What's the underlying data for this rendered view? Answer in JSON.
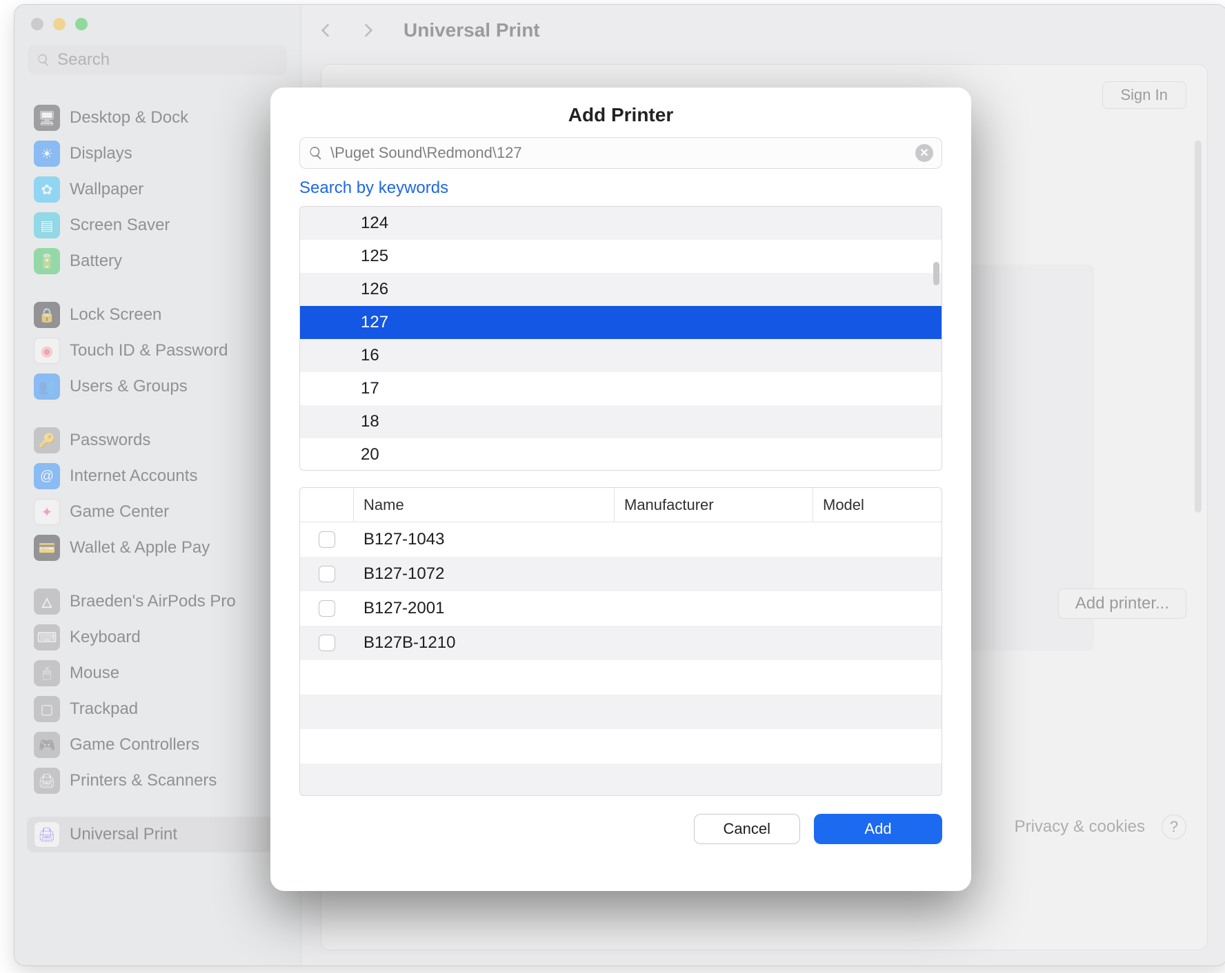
{
  "sidebar": {
    "search_placeholder": "Search",
    "items": [
      {
        "label": "Desktop & Dock",
        "icon_bg": "#4b4b4e",
        "glyph": "🖥"
      },
      {
        "label": "Displays",
        "icon_bg": "#1b88ff",
        "glyph": "☀"
      },
      {
        "label": "Wallpaper",
        "icon_bg": "#28c3ff",
        "glyph": "✿"
      },
      {
        "label": "Screen Saver",
        "icon_bg": "#2ec7e5",
        "glyph": "▤"
      },
      {
        "label": "Battery",
        "icon_bg": "#34c759",
        "glyph": "🔋"
      }
    ],
    "items2": [
      {
        "label": "Lock Screen",
        "icon_bg": "#2f2f32",
        "glyph": "🔒"
      },
      {
        "label": "Touch ID & Password",
        "icon_bg": "#ffffff",
        "glyph": "◉",
        "glyph_color": "#ff5a66",
        "border": true
      },
      {
        "label": "Users & Groups",
        "icon_bg": "#1b88ff",
        "glyph": "👥"
      }
    ],
    "items3": [
      {
        "label": "Passwords",
        "icon_bg": "#9d9da0",
        "glyph": "🔑"
      },
      {
        "label": "Internet Accounts",
        "icon_bg": "#1b88ff",
        "glyph": "@"
      },
      {
        "label": "Game Center",
        "icon_bg": "#ffffff",
        "glyph": "✦",
        "glyph_color": "#ff4da0",
        "border": true
      },
      {
        "label": "Wallet & Apple Pay",
        "icon_bg": "#323235",
        "glyph": "💳"
      }
    ],
    "items4": [
      {
        "label": "Braeden's AirPods Pro",
        "icon_bg": "#9d9da0",
        "glyph": "🜂"
      },
      {
        "label": "Keyboard",
        "icon_bg": "#9d9da0",
        "glyph": "⌨"
      },
      {
        "label": "Mouse",
        "icon_bg": "#9d9da0",
        "glyph": "🖱"
      },
      {
        "label": "Trackpad",
        "icon_bg": "#9d9da0",
        "glyph": "▢"
      },
      {
        "label": "Game Controllers",
        "icon_bg": "#9d9da0",
        "glyph": "🎮"
      },
      {
        "label": "Printers & Scanners",
        "icon_bg": "#9d9da0",
        "glyph": "🖨"
      }
    ],
    "selected": {
      "label": "Universal Print",
      "icon_bg": "#ffffff",
      "glyph": "🖨",
      "glyph_color": "#7a5cff",
      "border": true
    }
  },
  "header": {
    "title": "Universal Print"
  },
  "main": {
    "signin_label": "Sign In",
    "add_printer_label": "Add printer...",
    "privacy_label": "Privacy & cookies",
    "help_label": "?"
  },
  "modal": {
    "title": "Add Printer",
    "search_value": "\\Puget Sound\\Redmond\\127",
    "keywords_link": "Search by keywords",
    "locations": [
      "124",
      "125",
      "126",
      "127",
      "16",
      "17",
      "18",
      "20"
    ],
    "selected_location_index": 3,
    "columns": {
      "name": "Name",
      "manufacturer": "Manufacturer",
      "model": "Model"
    },
    "printers": [
      {
        "name": "B127-1043",
        "manufacturer": "",
        "model": ""
      },
      {
        "name": "B127-1072",
        "manufacturer": "",
        "model": ""
      },
      {
        "name": "B127-2001",
        "manufacturer": "",
        "model": ""
      },
      {
        "name": "B127B-1210",
        "manufacturer": "",
        "model": ""
      }
    ],
    "cancel_label": "Cancel",
    "add_label": "Add"
  }
}
